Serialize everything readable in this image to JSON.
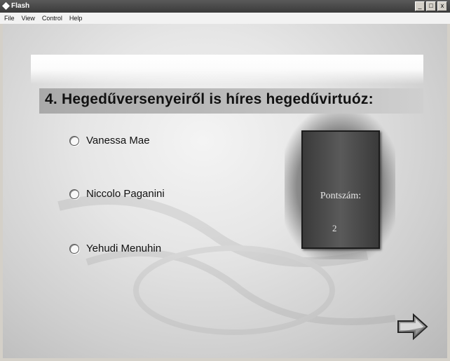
{
  "window": {
    "title": "Flash",
    "controls": [
      "_",
      "□",
      "x"
    ]
  },
  "menu": [
    "File",
    "View",
    "Control",
    "Help"
  ],
  "quiz": {
    "question": "4. Hegedűversenyeiről is híres hegedűvirtuóz:",
    "answers": [
      "Vanessa Mae",
      "Niccolo Paganini",
      "Yehudi Menuhin"
    ],
    "selected": null
  },
  "score": {
    "label": "Pontszám:",
    "value": "2"
  },
  "icons": {
    "app": "flash-icon",
    "next": "right-arrow-icon"
  }
}
